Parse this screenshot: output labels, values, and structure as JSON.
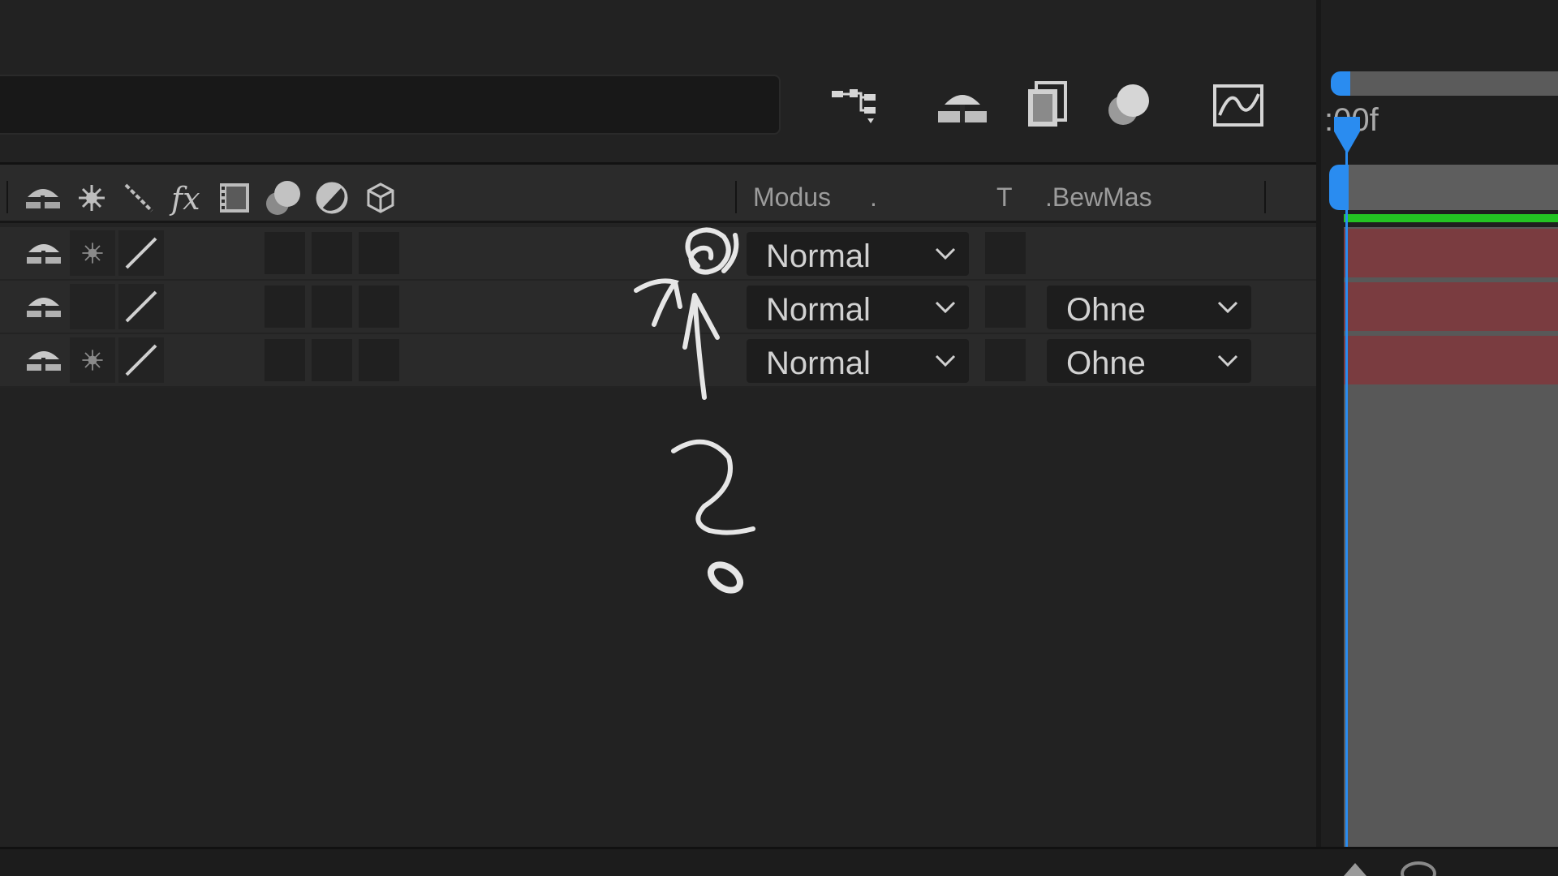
{
  "panel": {
    "header": {
      "modus_label": "Modus",
      "dot_label": ".",
      "t_label": "T",
      "bewmas_label": ".BewMas"
    },
    "layers": [
      {
        "mode": "Normal",
        "track_matte": "",
        "has_star": true
      },
      {
        "mode": "Normal",
        "track_matte": "Ohne",
        "has_star": false
      },
      {
        "mode": "Normal",
        "track_matte": "Ohne",
        "has_star": true
      }
    ]
  },
  "timeline": {
    "timecode": ":00f"
  },
  "colors": {
    "playhead": "#2a8cf0",
    "work_area": "#23c423",
    "layer_bar": "#7a3c40"
  }
}
